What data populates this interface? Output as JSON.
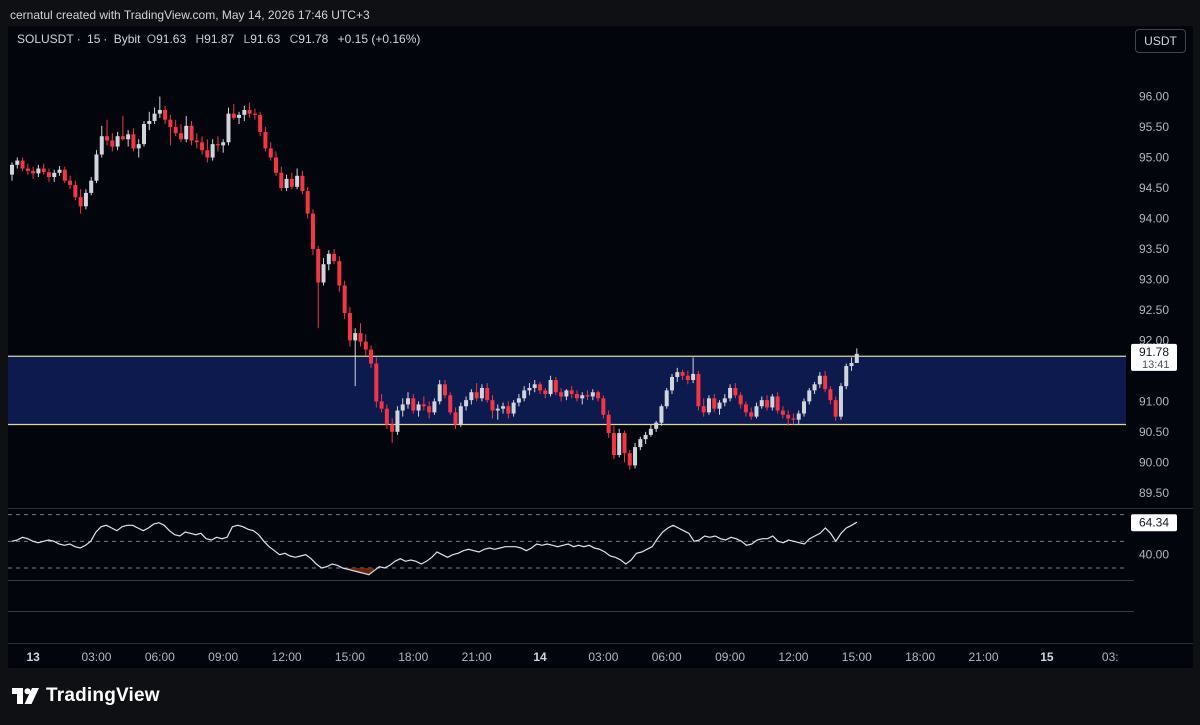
{
  "header": {
    "credit": "cernatul created with TradingView.com, May 14, 2026 17:46 UTC+3"
  },
  "legend": {
    "symbol": "SOLUSDT",
    "interval": "15",
    "exchange": "Bybit",
    "open_label": "O",
    "open": "91.63",
    "high_label": "H",
    "high": "91.87",
    "low_label": "L",
    "low": "91.63",
    "close_label": "C",
    "close": "91.78",
    "change": "+0.15 (+0.16%)"
  },
  "currency_button": "USDT",
  "brand": {
    "name": "TradingView",
    "logo": "tradingview-logo"
  },
  "colors": {
    "background": "#03050d",
    "up": "#d1d4dc",
    "down": "#f23645",
    "zone_fill": "#0c1a4e",
    "zone_line": "#d8d8a0",
    "rsi_line": "#e0e3eb",
    "rsi_oversold_fill": "#8a2b0e"
  },
  "chart_data": [
    {
      "type": "candlestick",
      "title": "",
      "price_axis": {
        "ticks": [
          96.0,
          95.5,
          95.0,
          94.5,
          94.0,
          93.5,
          93.0,
          92.5,
          92.0,
          91.5,
          91.0,
          90.5,
          90.0,
          89.5
        ],
        "tick_labels": [
          "96.00",
          "95.50",
          "95.00",
          "94.50",
          "94.00",
          "93.50",
          "93.00",
          "92.50",
          "92.00",
          "",
          "91.00",
          "90.50",
          "90.00",
          "89.50"
        ],
        "range": [
          89.3,
          96.6
        ],
        "last_price": 91.78,
        "last_price_label": "91.78",
        "countdown": "13:41"
      },
      "time_axis": {
        "labels": [
          "13",
          "03:00",
          "06:00",
          "09:00",
          "12:00",
          "15:00",
          "18:00",
          "21:00",
          "14",
          "03:00",
          "06:00",
          "09:00",
          "12:00",
          "15:00",
          "18:00",
          "21:00",
          "15",
          "03:"
        ],
        "bold_labels": [
          "13",
          "14",
          "15"
        ],
        "bars_per_label": 12,
        "first_label_bar": 4
      },
      "zone": {
        "upper": 91.74,
        "lower": 90.62
      },
      "bars_ohlc": [
        [
          94.72,
          94.92,
          94.62,
          94.88
        ],
        [
          94.88,
          95.0,
          94.82,
          94.95
        ],
        [
          94.95,
          95.0,
          94.78,
          94.82
        ],
        [
          94.82,
          94.9,
          94.72,
          94.78
        ],
        [
          94.78,
          94.85,
          94.65,
          94.74
        ],
        [
          94.74,
          94.88,
          94.68,
          94.82
        ],
        [
          94.82,
          94.9,
          94.72,
          94.76
        ],
        [
          94.76,
          94.82,
          94.6,
          94.68
        ],
        [
          94.68,
          94.8,
          94.6,
          94.75
        ],
        [
          94.75,
          94.86,
          94.7,
          94.8
        ],
        [
          94.8,
          94.85,
          94.58,
          94.62
        ],
        [
          94.62,
          94.7,
          94.48,
          94.55
        ],
        [
          94.55,
          94.62,
          94.3,
          94.35
        ],
        [
          94.35,
          94.48,
          94.08,
          94.2
        ],
        [
          94.2,
          94.48,
          94.15,
          94.42
        ],
        [
          94.42,
          94.68,
          94.38,
          94.62
        ],
        [
          94.62,
          95.12,
          94.58,
          95.05
        ],
        [
          95.05,
          95.52,
          95.0,
          95.35
        ],
        [
          95.35,
          95.62,
          95.2,
          95.28
        ],
        [
          95.28,
          95.4,
          95.1,
          95.18
        ],
        [
          95.18,
          95.42,
          95.12,
          95.35
        ],
        [
          95.35,
          95.68,
          95.28,
          95.3
        ],
        [
          95.3,
          95.45,
          95.18,
          95.38
        ],
        [
          95.38,
          95.48,
          95.1,
          95.15
        ],
        [
          95.15,
          95.3,
          95.0,
          95.22
        ],
        [
          95.22,
          95.6,
          95.18,
          95.55
        ],
        [
          95.55,
          95.75,
          95.45,
          95.6
        ],
        [
          95.6,
          95.82,
          95.55,
          95.72
        ],
        [
          95.72,
          96.0,
          95.65,
          95.78
        ],
        [
          95.78,
          95.85,
          95.55,
          95.62
        ],
        [
          95.62,
          95.7,
          95.2,
          95.5
        ],
        [
          95.5,
          95.62,
          95.35,
          95.4
        ],
        [
          95.4,
          95.55,
          95.25,
          95.3
        ],
        [
          95.3,
          95.68,
          95.25,
          95.52
        ],
        [
          95.52,
          95.6,
          95.2,
          95.28
        ],
        [
          95.28,
          95.4,
          95.15,
          95.25
        ],
        [
          95.25,
          95.35,
          95.05,
          95.12
        ],
        [
          95.12,
          95.3,
          94.92,
          95.0
        ],
        [
          95.0,
          95.3,
          94.95,
          95.22
        ],
        [
          95.22,
          95.35,
          95.1,
          95.2
        ],
        [
          95.2,
          95.3,
          95.08,
          95.25
        ],
        [
          95.25,
          95.82,
          95.2,
          95.72
        ],
        [
          95.72,
          95.88,
          95.62,
          95.65
        ],
        [
          95.65,
          95.75,
          95.55,
          95.7
        ],
        [
          95.7,
          95.85,
          95.6,
          95.78
        ],
        [
          95.78,
          95.9,
          95.65,
          95.72
        ],
        [
          95.72,
          95.8,
          95.62,
          95.7
        ],
        [
          95.7,
          95.75,
          95.35,
          95.42
        ],
        [
          95.42,
          95.5,
          95.1,
          95.15
        ],
        [
          95.15,
          95.25,
          94.95,
          95.0
        ],
        [
          95.0,
          95.1,
          94.7,
          94.75
        ],
        [
          94.75,
          94.85,
          94.45,
          94.5
        ],
        [
          94.5,
          94.72,
          94.45,
          94.65
        ],
        [
          94.65,
          94.75,
          94.48,
          94.52
        ],
        [
          94.52,
          94.82,
          94.48,
          94.7
        ],
        [
          94.7,
          94.78,
          94.4,
          94.45
        ],
        [
          94.45,
          94.52,
          94.0,
          94.08
        ],
        [
          94.08,
          94.15,
          93.4,
          93.5
        ],
        [
          93.5,
          93.55,
          92.2,
          92.95
        ],
        [
          92.95,
          93.35,
          92.9,
          93.25
        ],
        [
          93.25,
          93.48,
          93.15,
          93.42
        ],
        [
          93.42,
          93.5,
          93.25,
          93.3
        ],
        [
          93.3,
          93.38,
          92.8,
          92.9
        ],
        [
          92.9,
          92.98,
          92.35,
          92.45
        ],
        [
          92.45,
          92.55,
          91.9,
          92.0
        ],
        [
          92.0,
          92.2,
          91.25,
          92.12
        ],
        [
          92.12,
          92.28,
          91.9,
          91.98
        ],
        [
          91.98,
          92.1,
          91.75,
          91.85
        ],
        [
          91.85,
          91.92,
          91.55,
          91.62
        ],
        [
          91.62,
          91.72,
          90.9,
          91.0
        ],
        [
          91.0,
          91.12,
          90.82,
          90.88
        ],
        [
          90.88,
          90.95,
          90.55,
          90.62
        ],
        [
          90.62,
          90.72,
          90.32,
          90.5
        ],
        [
          90.5,
          90.92,
          90.45,
          90.85
        ],
        [
          90.85,
          91.05,
          90.75,
          90.95
        ],
        [
          90.95,
          91.15,
          90.88,
          91.05
        ],
        [
          91.05,
          91.12,
          90.8,
          90.85
        ],
        [
          90.85,
          91.0,
          90.75,
          90.95
        ],
        [
          90.95,
          91.08,
          90.85,
          90.92
        ],
        [
          90.92,
          91.0,
          90.72,
          90.82
        ],
        [
          90.82,
          91.05,
          90.78,
          91.0
        ],
        [
          91.0,
          91.35,
          90.95,
          91.28
        ],
        [
          91.28,
          91.35,
          91.05,
          91.1
        ],
        [
          91.1,
          91.15,
          90.78,
          90.82
        ],
        [
          90.82,
          90.9,
          90.55,
          90.62
        ],
        [
          90.62,
          90.98,
          90.58,
          90.92
        ],
        [
          90.92,
          91.08,
          90.85,
          91.02
        ],
        [
          91.02,
          91.2,
          90.95,
          91.15
        ],
        [
          91.15,
          91.3,
          91.0,
          91.05
        ],
        [
          91.05,
          91.28,
          91.0,
          91.22
        ],
        [
          91.22,
          91.3,
          90.98,
          91.02
        ],
        [
          91.02,
          91.1,
          90.72,
          90.85
        ],
        [
          90.85,
          90.95,
          90.7,
          90.88
        ],
        [
          90.88,
          90.98,
          90.8,
          90.92
        ],
        [
          90.92,
          91.0,
          90.72,
          90.8
        ],
        [
          90.8,
          91.02,
          90.75,
          90.98
        ],
        [
          90.98,
          91.12,
          90.92,
          91.05
        ],
        [
          91.05,
          91.25,
          91.0,
          91.18
        ],
        [
          91.18,
          91.3,
          91.1,
          91.22
        ],
        [
          91.22,
          91.35,
          91.15,
          91.28
        ],
        [
          91.28,
          91.32,
          91.12,
          91.18
        ],
        [
          91.18,
          91.22,
          91.05,
          91.12
        ],
        [
          91.12,
          91.42,
          91.08,
          91.35
        ],
        [
          91.35,
          91.4,
          91.1,
          91.15
        ],
        [
          91.15,
          91.22,
          91.0,
          91.08
        ],
        [
          91.08,
          91.2,
          91.02,
          91.18
        ],
        [
          91.18,
          91.25,
          91.05,
          91.12
        ],
        [
          91.12,
          91.18,
          91.0,
          91.05
        ],
        [
          91.05,
          91.15,
          90.95,
          91.1
        ],
        [
          91.1,
          91.18,
          91.02,
          91.08
        ],
        [
          91.08,
          91.2,
          91.02,
          91.15
        ],
        [
          91.15,
          91.18,
          91.0,
          91.05
        ],
        [
          91.05,
          91.1,
          90.72,
          90.78
        ],
        [
          90.78,
          90.85,
          90.4,
          90.48
        ],
        [
          90.48,
          90.6,
          90.05,
          90.12
        ],
        [
          90.12,
          90.55,
          90.08,
          90.48
        ],
        [
          90.48,
          90.52,
          90.0,
          90.15
        ],
        [
          90.15,
          90.2,
          89.88,
          89.95
        ],
        [
          89.95,
          90.32,
          89.9,
          90.25
        ],
        [
          90.25,
          90.42,
          90.2,
          90.38
        ],
        [
          90.38,
          90.5,
          90.3,
          90.45
        ],
        [
          90.45,
          90.62,
          90.42,
          90.55
        ],
        [
          90.55,
          90.68,
          90.5,
          90.65
        ],
        [
          90.65,
          90.95,
          90.6,
          90.92
        ],
        [
          90.92,
          91.22,
          90.88,
          91.18
        ],
        [
          91.18,
          91.45,
          91.12,
          91.4
        ],
        [
          91.4,
          91.55,
          91.32,
          91.48
        ],
        [
          91.48,
          91.52,
          91.35,
          91.42
        ],
        [
          91.42,
          91.5,
          91.28,
          91.35
        ],
        [
          91.35,
          91.72,
          91.3,
          91.45
        ],
        [
          91.45,
          91.5,
          90.85,
          90.92
        ],
        [
          90.92,
          91.05,
          90.75,
          90.82
        ],
        [
          90.82,
          91.1,
          90.78,
          91.05
        ],
        [
          91.05,
          91.12,
          90.82,
          90.88
        ],
        [
          90.88,
          91.02,
          90.78,
          90.98
        ],
        [
          90.98,
          91.12,
          90.92,
          91.05
        ],
        [
          91.05,
          91.28,
          91.0,
          91.22
        ],
        [
          91.22,
          91.3,
          91.05,
          91.1
        ],
        [
          91.1,
          91.15,
          90.88,
          90.95
        ],
        [
          90.95,
          91.0,
          90.75,
          90.82
        ],
        [
          90.82,
          90.9,
          90.7,
          90.75
        ],
        [
          90.75,
          90.98,
          90.72,
          90.92
        ],
        [
          90.92,
          91.08,
          90.88,
          91.02
        ],
        [
          91.02,
          91.1,
          90.85,
          90.9
        ],
        [
          90.9,
          91.12,
          90.85,
          91.08
        ],
        [
          91.08,
          91.15,
          90.8,
          90.85
        ],
        [
          90.85,
          90.92,
          90.72,
          90.78
        ],
        [
          90.78,
          90.85,
          90.6,
          90.72
        ],
        [
          90.72,
          90.8,
          90.62,
          90.7
        ],
        [
          90.7,
          90.85,
          90.62,
          90.8
        ],
        [
          90.8,
          91.05,
          90.75,
          91.0
        ],
        [
          91.0,
          91.22,
          90.95,
          91.18
        ],
        [
          91.18,
          91.32,
          91.12,
          91.28
        ],
        [
          91.28,
          91.48,
          91.22,
          91.42
        ],
        [
          91.42,
          91.5,
          91.15,
          91.2
        ],
        [
          91.2,
          91.25,
          90.95,
          91.02
        ],
        [
          91.02,
          91.08,
          90.68,
          90.75
        ],
        [
          90.75,
          91.3,
          90.7,
          91.25
        ],
        [
          91.25,
          91.62,
          91.2,
          91.58
        ],
        [
          91.58,
          91.72,
          91.5,
          91.63
        ],
        [
          91.63,
          91.87,
          91.63,
          91.78
        ]
      ]
    },
    {
      "type": "line",
      "title": "",
      "indicator_panel": "RSI",
      "range": [
        21,
        72
      ],
      "levels": {
        "upper": 70,
        "middle": 50,
        "lower": 30
      },
      "tick_labels": [
        "40.00"
      ],
      "last_value": 64.34,
      "last_value_label": "64.34",
      "values": [
        50,
        51,
        53,
        52,
        50,
        49,
        50,
        51,
        50,
        48,
        47,
        48,
        46,
        45,
        47,
        50,
        57,
        61,
        62,
        60,
        58,
        61,
        62,
        62,
        60,
        58,
        60,
        63,
        64,
        62,
        58,
        55,
        54,
        57,
        56,
        55,
        56,
        52,
        51,
        53,
        52,
        53,
        61,
        62,
        61,
        59,
        58,
        55,
        50,
        46,
        43,
        40,
        41,
        39,
        38,
        39,
        40,
        37,
        33,
        30,
        31,
        33,
        32,
        30,
        29,
        28,
        27,
        26,
        25,
        28,
        31,
        30,
        32,
        35,
        37,
        35,
        36,
        35,
        33,
        35,
        38,
        42,
        40,
        38,
        40,
        41,
        43,
        44,
        43,
        42,
        44,
        45,
        44,
        45,
        46,
        46,
        46,
        45,
        43,
        45,
        48,
        47,
        48,
        47,
        46,
        47,
        48,
        46,
        47,
        46,
        47,
        45,
        44,
        42,
        39,
        38,
        36,
        33,
        36,
        41,
        42,
        44,
        46,
        52,
        57,
        60,
        62,
        60,
        58,
        56,
        50,
        51,
        54,
        53,
        54,
        52,
        51,
        53,
        52,
        50,
        47,
        48,
        51,
        52,
        52,
        54,
        50,
        49,
        51,
        50,
        49,
        48,
        52,
        54,
        56,
        60,
        56,
        50,
        56,
        60,
        62,
        64.34
      ]
    }
  ]
}
